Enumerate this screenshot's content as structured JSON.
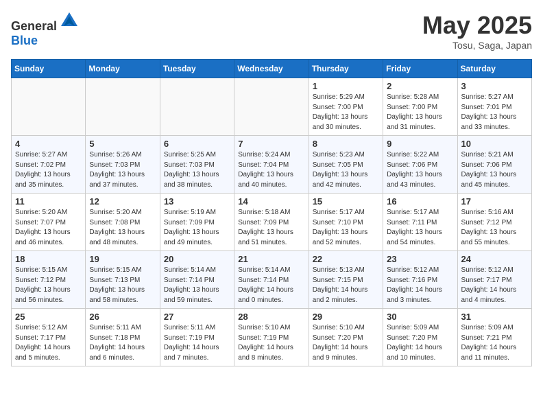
{
  "header": {
    "logo_general": "General",
    "logo_blue": "Blue",
    "title": "May 2025",
    "subtitle": "Tosu, Saga, Japan"
  },
  "weekdays": [
    "Sunday",
    "Monday",
    "Tuesday",
    "Wednesday",
    "Thursday",
    "Friday",
    "Saturday"
  ],
  "weeks": [
    [
      {
        "day": "",
        "detail": ""
      },
      {
        "day": "",
        "detail": ""
      },
      {
        "day": "",
        "detail": ""
      },
      {
        "day": "",
        "detail": ""
      },
      {
        "day": "1",
        "detail": "Sunrise: 5:29 AM\nSunset: 7:00 PM\nDaylight: 13 hours\nand 30 minutes."
      },
      {
        "day": "2",
        "detail": "Sunrise: 5:28 AM\nSunset: 7:00 PM\nDaylight: 13 hours\nand 31 minutes."
      },
      {
        "day": "3",
        "detail": "Sunrise: 5:27 AM\nSunset: 7:01 PM\nDaylight: 13 hours\nand 33 minutes."
      }
    ],
    [
      {
        "day": "4",
        "detail": "Sunrise: 5:27 AM\nSunset: 7:02 PM\nDaylight: 13 hours\nand 35 minutes."
      },
      {
        "day": "5",
        "detail": "Sunrise: 5:26 AM\nSunset: 7:03 PM\nDaylight: 13 hours\nand 37 minutes."
      },
      {
        "day": "6",
        "detail": "Sunrise: 5:25 AM\nSunset: 7:03 PM\nDaylight: 13 hours\nand 38 minutes."
      },
      {
        "day": "7",
        "detail": "Sunrise: 5:24 AM\nSunset: 7:04 PM\nDaylight: 13 hours\nand 40 minutes."
      },
      {
        "day": "8",
        "detail": "Sunrise: 5:23 AM\nSunset: 7:05 PM\nDaylight: 13 hours\nand 42 minutes."
      },
      {
        "day": "9",
        "detail": "Sunrise: 5:22 AM\nSunset: 7:06 PM\nDaylight: 13 hours\nand 43 minutes."
      },
      {
        "day": "10",
        "detail": "Sunrise: 5:21 AM\nSunset: 7:06 PM\nDaylight: 13 hours\nand 45 minutes."
      }
    ],
    [
      {
        "day": "11",
        "detail": "Sunrise: 5:20 AM\nSunset: 7:07 PM\nDaylight: 13 hours\nand 46 minutes."
      },
      {
        "day": "12",
        "detail": "Sunrise: 5:20 AM\nSunset: 7:08 PM\nDaylight: 13 hours\nand 48 minutes."
      },
      {
        "day": "13",
        "detail": "Sunrise: 5:19 AM\nSunset: 7:09 PM\nDaylight: 13 hours\nand 49 minutes."
      },
      {
        "day": "14",
        "detail": "Sunrise: 5:18 AM\nSunset: 7:09 PM\nDaylight: 13 hours\nand 51 minutes."
      },
      {
        "day": "15",
        "detail": "Sunrise: 5:17 AM\nSunset: 7:10 PM\nDaylight: 13 hours\nand 52 minutes."
      },
      {
        "day": "16",
        "detail": "Sunrise: 5:17 AM\nSunset: 7:11 PM\nDaylight: 13 hours\nand 54 minutes."
      },
      {
        "day": "17",
        "detail": "Sunrise: 5:16 AM\nSunset: 7:12 PM\nDaylight: 13 hours\nand 55 minutes."
      }
    ],
    [
      {
        "day": "18",
        "detail": "Sunrise: 5:15 AM\nSunset: 7:12 PM\nDaylight: 13 hours\nand 56 minutes."
      },
      {
        "day": "19",
        "detail": "Sunrise: 5:15 AM\nSunset: 7:13 PM\nDaylight: 13 hours\nand 58 minutes."
      },
      {
        "day": "20",
        "detail": "Sunrise: 5:14 AM\nSunset: 7:14 PM\nDaylight: 13 hours\nand 59 minutes."
      },
      {
        "day": "21",
        "detail": "Sunrise: 5:14 AM\nSunset: 7:14 PM\nDaylight: 14 hours\nand 0 minutes."
      },
      {
        "day": "22",
        "detail": "Sunrise: 5:13 AM\nSunset: 7:15 PM\nDaylight: 14 hours\nand 2 minutes."
      },
      {
        "day": "23",
        "detail": "Sunrise: 5:12 AM\nSunset: 7:16 PM\nDaylight: 14 hours\nand 3 minutes."
      },
      {
        "day": "24",
        "detail": "Sunrise: 5:12 AM\nSunset: 7:17 PM\nDaylight: 14 hours\nand 4 minutes."
      }
    ],
    [
      {
        "day": "25",
        "detail": "Sunrise: 5:12 AM\nSunset: 7:17 PM\nDaylight: 14 hours\nand 5 minutes."
      },
      {
        "day": "26",
        "detail": "Sunrise: 5:11 AM\nSunset: 7:18 PM\nDaylight: 14 hours\nand 6 minutes."
      },
      {
        "day": "27",
        "detail": "Sunrise: 5:11 AM\nSunset: 7:19 PM\nDaylight: 14 hours\nand 7 minutes."
      },
      {
        "day": "28",
        "detail": "Sunrise: 5:10 AM\nSunset: 7:19 PM\nDaylight: 14 hours\nand 8 minutes."
      },
      {
        "day": "29",
        "detail": "Sunrise: 5:10 AM\nSunset: 7:20 PM\nDaylight: 14 hours\nand 9 minutes."
      },
      {
        "day": "30",
        "detail": "Sunrise: 5:09 AM\nSunset: 7:20 PM\nDaylight: 14 hours\nand 10 minutes."
      },
      {
        "day": "31",
        "detail": "Sunrise: 5:09 AM\nSunset: 7:21 PM\nDaylight: 14 hours\nand 11 minutes."
      }
    ]
  ]
}
